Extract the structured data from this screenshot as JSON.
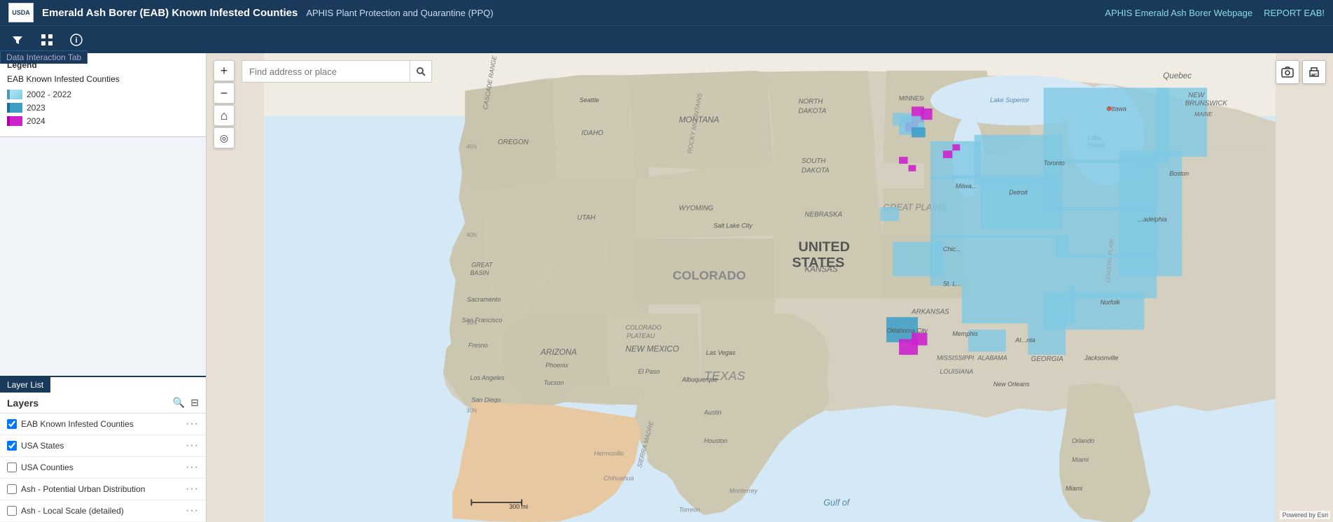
{
  "header": {
    "logo_text": "USDA",
    "title": "Emerald Ash Borer (EAB) Known Infested Counties",
    "subtitle": "APHIS Plant Protection and Quarantine (PPQ)",
    "link1": "APHIS Emerald Ash Borer Webpage",
    "link2": "REPORT EAB!"
  },
  "toolbar": {
    "filter_icon": "▼",
    "grid_icon": "⊞",
    "info_icon": "ℹ",
    "data_tab_label": "Data Interaction Tab"
  },
  "legend": {
    "title": "Legend",
    "subtitle": "EAB Known Infested Counties",
    "items": [
      {
        "label": "2002 - 2022",
        "color": "#7ec8e3",
        "border": "#4a9ab5"
      },
      {
        "label": "2023",
        "color": "#3a9ec8",
        "border": "#1a6e98"
      },
      {
        "label": "2024",
        "color": "#cc22cc",
        "border": "#aa00aa"
      }
    ]
  },
  "layer_list": {
    "tab_label": "Layer List",
    "layers_title": "Layers",
    "search_icon": "🔍",
    "filter_icon": "⊟",
    "layers": [
      {
        "name": "EAB Known Infested Counties",
        "checked": true
      },
      {
        "name": "USA States",
        "checked": true
      },
      {
        "name": "USA Counties",
        "checked": false
      },
      {
        "name": "Ash - Potential Urban Distribution",
        "checked": false
      },
      {
        "name": "Ash - Local Scale (detailed)",
        "checked": false
      }
    ]
  },
  "map": {
    "search_placeholder": "Find address or place",
    "zoom_in": "+",
    "zoom_out": "−",
    "home_icon": "⌂",
    "locate_icon": "◎",
    "screenshot_icon": "📷",
    "print_icon": "🖨",
    "attribution": "Powered by Esri",
    "scale_label": "300 mi",
    "colorado_label": "COLORADO",
    "united_states_label": "UNITED STATES"
  }
}
